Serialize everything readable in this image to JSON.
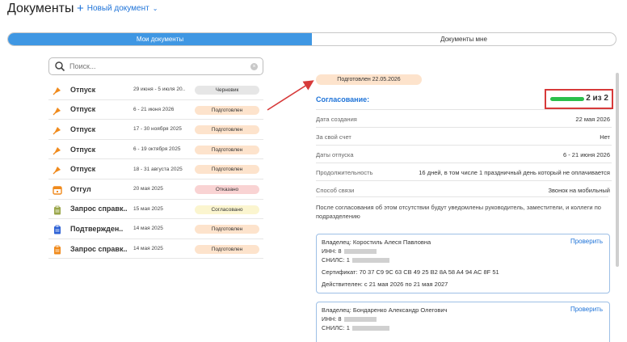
{
  "header": {
    "title": "Документы",
    "new_document": "Новый документ"
  },
  "tabs": [
    {
      "label": "Мои документы",
      "active": true
    },
    {
      "label": "Документы мне",
      "active": false
    }
  ],
  "search": {
    "placeholder": "Поиск..."
  },
  "documents": [
    {
      "icon": "vacation-icon",
      "name": "Отпуск",
      "dates": "29 июня - 5 июля 20..",
      "status": "Черновик",
      "status_color": "#e6e6e6"
    },
    {
      "icon": "vacation-icon",
      "name": "Отпуск",
      "dates": "6 - 21 июня 2026",
      "status": "Подготовлен",
      "status_color": "#fde3cc"
    },
    {
      "icon": "vacation-icon",
      "name": "Отпуск",
      "dates": "17 - 30 ноября 2025",
      "status": "Подготовлен",
      "status_color": "#fde3cc"
    },
    {
      "icon": "vacation-icon",
      "name": "Отпуск",
      "dates": "6 - 19 октября 2025",
      "status": "Подготовлен",
      "status_color": "#fde3cc"
    },
    {
      "icon": "vacation-icon",
      "name": "Отпуск",
      "dates": "18 - 31 августа 2025",
      "status": "Подготовлен",
      "status_color": "#fde3cc"
    },
    {
      "icon": "calendar-icon",
      "name": "Отгул",
      "dates": "20 мая 2025",
      "status": "Отказано",
      "status_color": "#f9d3d3"
    },
    {
      "icon": "clipboard-icon",
      "name": "Запрос справк..",
      "dates": "15 мая 2025",
      "status": "Согласовано",
      "status_color": "#fbf5cf"
    },
    {
      "icon": "clipboard-icon",
      "name": "Подтвержден..",
      "dates": "14 мая 2025",
      "status": "Подготовлен",
      "status_color": "#fde3cc"
    },
    {
      "icon": "clipboard-icon",
      "name": "Запрос справк..",
      "dates": "14 мая 2025",
      "status": "Подготовлен",
      "status_color": "#fde3cc"
    }
  ],
  "details": {
    "status_pill": "Подготовлен 22.05.2026",
    "agreement_label": "Согласование:",
    "agreement_count": "2 из 2",
    "agreement_progress": 1.0,
    "fields": [
      {
        "label": "Дата создания",
        "value": "22 мая 2026"
      },
      {
        "label": "За свой счет",
        "value": "Нет"
      },
      {
        "label": "Даты отпуска",
        "value": "6 - 21 июня 2026"
      },
      {
        "label": "Продолжительность",
        "value": "16 дней, в том числе 1 праздничный день который не оплачивается"
      },
      {
        "label": "Способ связи",
        "value": "Звонок на мобильный"
      }
    ],
    "note": "После согласования об этом отсутствии будут уведомлены руководитель, заместители, и коллеги по подразделению",
    "signatures": [
      {
        "owner": "Владелец: Коростиль Алеся Павловна",
        "inn": "ИНН: 8",
        "snils": "СНИЛС: 1",
        "certificate": "Сертификат: 70 37 C9 9C 63 CB 49 25 B2 8A 58 A4 94 AC 8F 51",
        "valid": "Действителен: с 21 мая 2026 по 21 мая 2027",
        "check": "Проверить"
      },
      {
        "owner": "Владелец: Бондаренко Александр Олегович",
        "inn": "ИНН: 8",
        "snils": "СНИЛС: 1",
        "check": "Проверить"
      }
    ]
  },
  "colors": {
    "accent": "#3f97e3",
    "link": "#1e73d8",
    "highlight": "#d73a3a",
    "progress": "#2bbf4b",
    "icon_orange": "#f08a1c",
    "icon_blue": "#2f63d6"
  }
}
